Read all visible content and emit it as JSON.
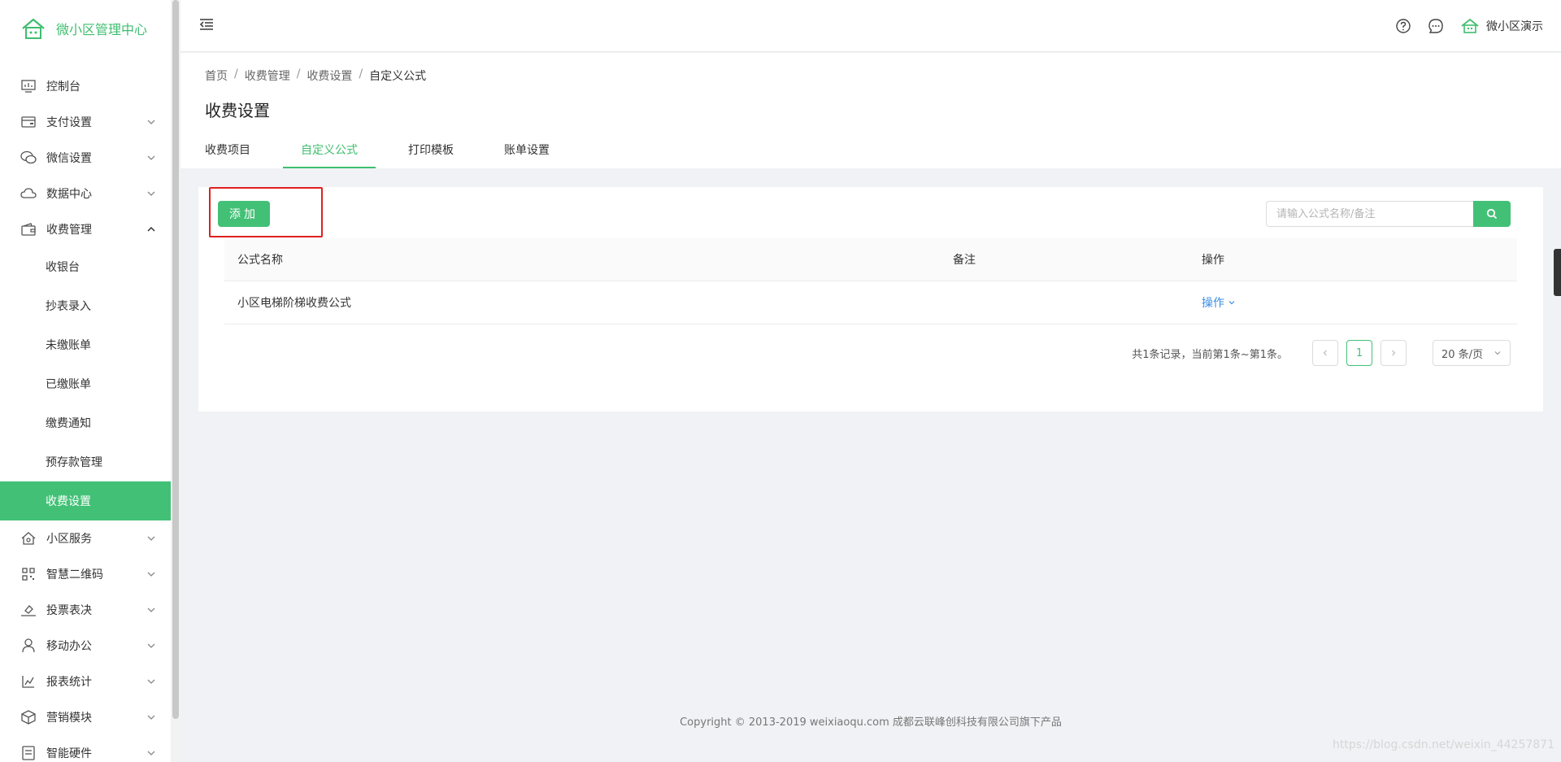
{
  "brand": {
    "name": "微小区管理中心"
  },
  "sidebar": {
    "items": [
      {
        "label": "控制台",
        "icon": "dashboard-icon"
      },
      {
        "label": "支付设置",
        "icon": "wallet-icon"
      },
      {
        "label": "微信设置",
        "icon": "wechat-icon"
      },
      {
        "label": "数据中心",
        "icon": "cloud-icon"
      },
      {
        "label": "收费管理",
        "icon": "purse-icon"
      }
    ],
    "sub_items": [
      {
        "label": "收银台"
      },
      {
        "label": "抄表录入"
      },
      {
        "label": "未缴账单"
      },
      {
        "label": "已缴账单"
      },
      {
        "label": "缴费通知"
      },
      {
        "label": "预存款管理"
      },
      {
        "label": "收费设置"
      }
    ],
    "items_after": [
      {
        "label": "小区服务",
        "icon": "home-icon"
      },
      {
        "label": "智慧二维码",
        "icon": "qrcode-icon"
      },
      {
        "label": "投票表决",
        "icon": "vote-icon"
      },
      {
        "label": "移动办公",
        "icon": "person-icon"
      },
      {
        "label": "报表统计",
        "icon": "chart-icon"
      },
      {
        "label": "营销模块",
        "icon": "cube-icon"
      },
      {
        "label": "智能硬件",
        "icon": "device-icon"
      }
    ]
  },
  "topbar": {
    "user_name": "微小区演示"
  },
  "breadcrumb": [
    "首页",
    "收费管理",
    "收费设置",
    "自定义公式"
  ],
  "page_title": "收费设置",
  "tabs": [
    "收费项目",
    "自定义公式",
    "打印模板",
    "账单设置"
  ],
  "toolbar": {
    "add_label": "添加",
    "search_placeholder": "请输入公式名称/备注"
  },
  "table": {
    "headers": [
      "公式名称",
      "备注",
      "操作"
    ],
    "rows": [
      {
        "name": "小区电梯阶梯收费公式",
        "remark": "",
        "action": "操作"
      }
    ]
  },
  "pagination": {
    "summary": "共1条记录，当前第1条~第1条。",
    "current_page": "1",
    "page_size": "20 条/页"
  },
  "footer": {
    "copyright": "Copyright © 2013-2019 weixiaoqu.com 成都云联峰创科技有限公司旗下产品"
  },
  "watermark": "https://blog.csdn.net/weixin_44257871",
  "colors": {
    "accent": "#42c176",
    "link": "#3b8ee6",
    "highlight": "#e02020"
  }
}
